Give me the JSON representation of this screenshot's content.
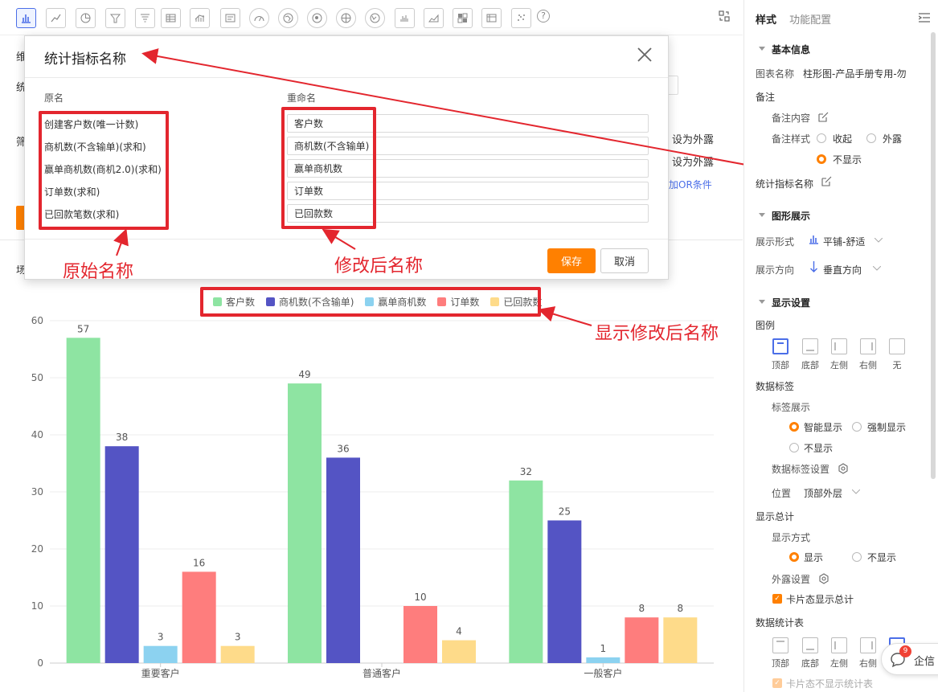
{
  "toolbar": {
    "chart_types": [
      "bar-chart-icon",
      "line-chart-icon",
      "pie-chart-icon",
      "funnel-icon",
      "funnel-alt-icon",
      "table-icon",
      "combo-chart-icon",
      "card-icon",
      "gauge-icon",
      "map-icon",
      "geo-map-icon",
      "globe-icon",
      "world-icon",
      "column-mini-icon",
      "area-chart-icon",
      "heatmap-icon",
      "pivot-table-icon",
      "scatter-icon"
    ],
    "help_icon": "?"
  },
  "background": {
    "frag_row1": "维",
    "frag_row2": "统",
    "frag_row3": "筛",
    "frag_row4": "场",
    "expose1": "设为外露",
    "expose2": "设为外露",
    "add_or": "添加OR条件"
  },
  "dialog": {
    "title": "统计指标名称",
    "col_original": "原名",
    "col_rename": "重命名",
    "original_names": [
      "创建客户数(唯一计数)",
      "商机数(不含输单)(求和)",
      "赢单商机数(商机2.0)(求和)",
      "订单数(求和)",
      "已回款笔数(求和)"
    ],
    "renamed": [
      "客户数",
      "商机数(不含输单)",
      "赢单商机数",
      "订单数",
      "已回款数"
    ],
    "save_label": "保存",
    "cancel_label": "取消"
  },
  "annotations": {
    "original_label": "原始名称",
    "renamed_label": "修改后名称",
    "legend_label": "显示修改后名称"
  },
  "colors": {
    "customer": "#8ee4a2",
    "opportunity": "#5454c4",
    "won": "#8cd2f0",
    "order": "#fe7d7d",
    "paid": "#fedb8a",
    "accent": "#ff8000",
    "annotation": "#e3262e"
  },
  "chart_data": {
    "type": "bar",
    "categories": [
      "重要客户",
      "普通客户",
      "一般客户"
    ],
    "series": [
      {
        "name": "客户数",
        "color": "#8ee4a2",
        "values": [
          57,
          49,
          32
        ]
      },
      {
        "name": "商机数(不含输单)",
        "color": "#5454c4",
        "values": [
          38,
          36,
          25
        ]
      },
      {
        "name": "赢单商机数",
        "color": "#8cd2f0",
        "values": [
          3,
          null,
          1
        ]
      },
      {
        "name": "订单数",
        "color": "#fe7d7d",
        "values": [
          16,
          10,
          8
        ]
      },
      {
        "name": "已回款数",
        "color": "#fedb8a",
        "values": [
          3,
          4,
          8
        ]
      }
    ],
    "ylim": [
      0,
      60
    ],
    "yticks": [
      0,
      10,
      20,
      30,
      40,
      50,
      60
    ],
    "data_labels": true,
    "grid": true,
    "legend": "top-center"
  },
  "panel": {
    "tab_style": "样式",
    "tab_function": "功能配置",
    "basic_info": "基本信息",
    "chart_name_label": "图表名称",
    "chart_name_value": "柱形图-产品手册专用-勿",
    "remark": "备注",
    "remark_content": "备注内容",
    "remark_style": "备注样式",
    "remark_collapse": "收起",
    "remark_expose": "外露",
    "remark_hide": "不显示",
    "metric_name": "统计指标名称",
    "graphic_display": "图形展示",
    "display_form_label": "展示形式",
    "display_form_value": "平铺-舒适",
    "display_dir_label": "展示方向",
    "display_dir_value": "垂直方向",
    "display_settings": "显示设置",
    "legend": "图例",
    "legend_positions": [
      "顶部",
      "底部",
      "左侧",
      "右侧",
      "无"
    ],
    "data_label": "数据标签",
    "label_display": "标签展示",
    "smart_display": "智能显示",
    "force_display": "强制显示",
    "no_display": "不显示",
    "data_label_settings": "数据标签设置",
    "position_label": "位置",
    "position_value": "顶部外层",
    "show_total": "显示总计",
    "display_mode": "显示方式",
    "show": "显示",
    "hide": "不显示",
    "expose_settings": "外露设置",
    "card_show_total": "卡片态显示总计",
    "data_stat_table": "数据统计表",
    "table_positions": [
      "顶部",
      "底部",
      "左侧",
      "右侧"
    ],
    "card_hide_table": "卡片态不显示统计表"
  },
  "chat": {
    "badge": "9",
    "label": "企信"
  }
}
